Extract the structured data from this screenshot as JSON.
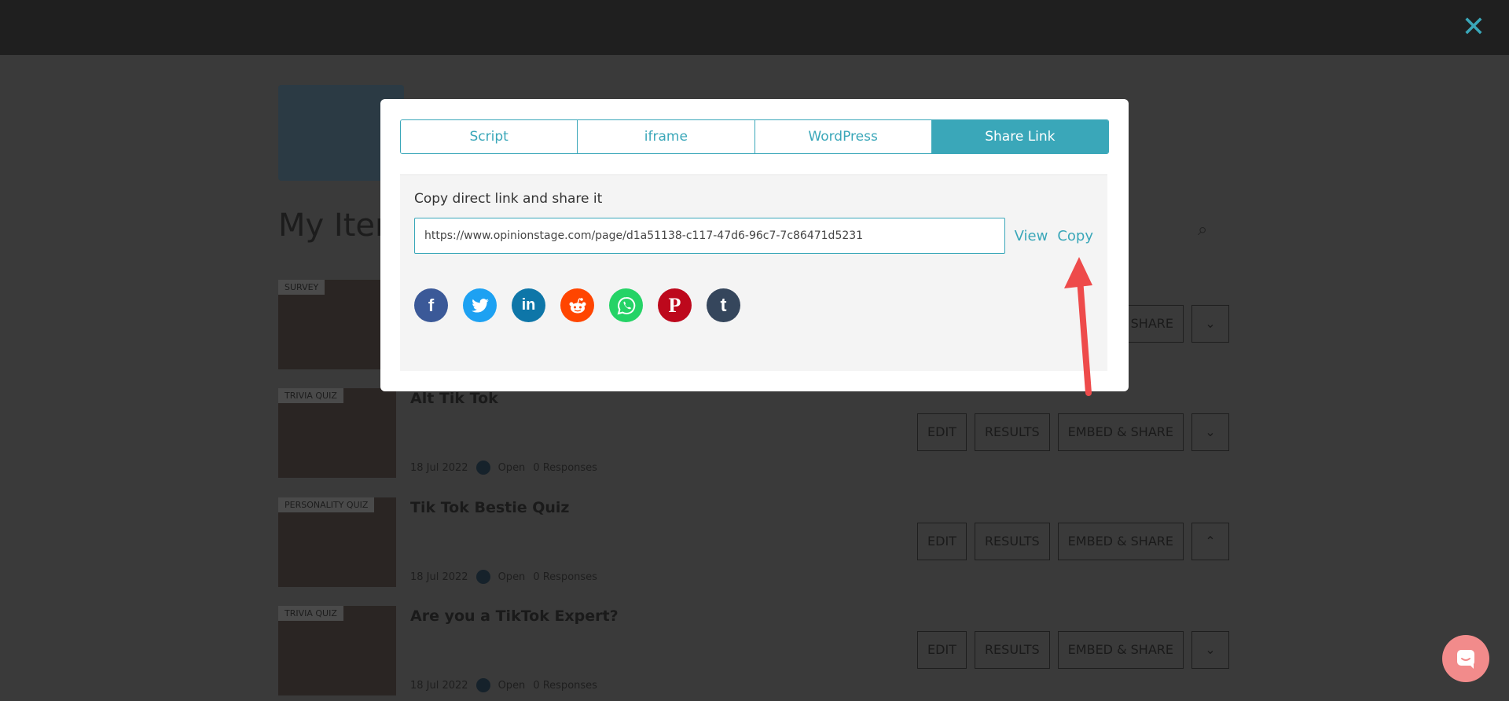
{
  "topbar": {
    "close_icon": "close-icon"
  },
  "background": {
    "title": "My Items",
    "rows": [
      {
        "tag": "SURVEY",
        "title": "",
        "date": "",
        "status": "",
        "responses": ""
      },
      {
        "tag": "TRIVIA QUIZ",
        "title": "Alt Tik Tok",
        "date": "18 Jul 2022",
        "status": "Open",
        "responses": "0 Responses"
      },
      {
        "tag": "PERSONALITY QUIZ",
        "title": "Tik Tok Bestie Quiz",
        "date": "18 Jul 2022",
        "status": "Open",
        "responses": "0 Responses"
      },
      {
        "tag": "TRIVIA QUIZ",
        "title": "Are you a TikTok Expert?",
        "date": "18 Jul 2022",
        "status": "Open",
        "responses": "0 Responses"
      }
    ],
    "buttons": {
      "edit": "EDIT",
      "results": "RESULTS",
      "embed": "EMBED & SHARE",
      "share": "SHARE"
    }
  },
  "modal": {
    "tabs": [
      "Script",
      "iframe",
      "WordPress",
      "Share Link"
    ],
    "active_tab": "Share Link",
    "label": "Copy direct link and share it",
    "link_value": "https://www.opinionstage.com/page/d1a51138-c117-47d6-96c7-7c86471d5231",
    "view_label": "View",
    "copy_label": "Copy",
    "socials": [
      {
        "name": "facebook",
        "color": "#3b5998",
        "glyph": "f"
      },
      {
        "name": "twitter",
        "color": "#1da1f2",
        "glyph": "t"
      },
      {
        "name": "linkedin",
        "color": "#0e76a8",
        "glyph": "in"
      },
      {
        "name": "reddit",
        "color": "#ff4500",
        "glyph": "r"
      },
      {
        "name": "whatsapp",
        "color": "#25d366",
        "glyph": "w"
      },
      {
        "name": "pinterest",
        "color": "#bd081c",
        "glyph": "P"
      },
      {
        "name": "tumblr",
        "color": "#35465c",
        "glyph": "t"
      }
    ]
  },
  "annotation": {
    "color": "#ee4b4b"
  },
  "chat": {
    "icon": "chat-icon",
    "color": "#f28b8b"
  }
}
